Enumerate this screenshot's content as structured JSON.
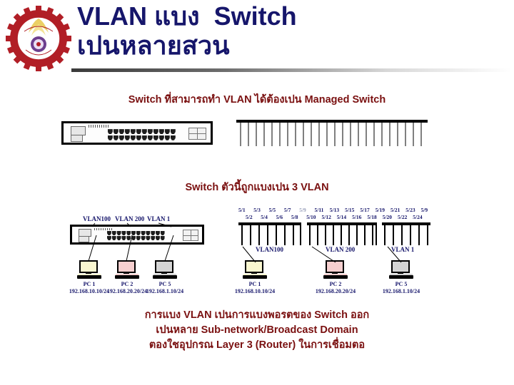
{
  "header": {
    "title_line1": "VLAN แบง  Switch",
    "title_line2": "เปนหลายสวน",
    "logo_name": "university-seal-logo",
    "title_color": "#16166b",
    "rule_color": "#3a3a3a"
  },
  "sections": {
    "caption1": "Switch ที่สามารถทำ VLAN ได้ต้องเปน Managed Switch",
    "caption2": "Switch ตัวนี้ถูกแบงเปน 3 VLAN"
  },
  "vlans": [
    {
      "name": "VLAN100",
      "ports": [
        "5/1",
        "5/2",
        "5/3",
        "5/4",
        "5/5",
        "5/6",
        "5/7",
        "5/8"
      ]
    },
    {
      "name": "VLAN 200",
      "ports": [
        "5/9",
        "5/10",
        "5/11",
        "5/12",
        "5/13",
        "5/14",
        "5/15",
        "5/16",
        "5/17",
        "5/18"
      ]
    },
    {
      "name": "VLAN 1",
      "ports": [
        "5/19",
        "5/20",
        "5/21",
        "5/22",
        "5/23",
        "5/24"
      ]
    }
  ],
  "port_labels_top": [
    "5/1",
    "5/3",
    "5/5",
    "5/7",
    "5/9",
    "5/11",
    "5/13",
    "5/15",
    "5/17",
    "5/19",
    "5/21",
    "5/23",
    "5/9"
  ],
  "port_labels_bottom": [
    "5/2",
    "5/4",
    "5/6",
    "5/8",
    "5/10",
    "5/12",
    "5/14",
    "5/16",
    "5/18",
    "5/20",
    "5/22",
    "5/24"
  ],
  "hosts": [
    {
      "name": "PC 1",
      "ip": "192.168.10.10/24",
      "color": "#faf7d0",
      "vlan": "VLAN100"
    },
    {
      "name": "PC 2",
      "ip": "192.168.20.20/24",
      "color": "#f6cfcf",
      "vlan": "VLAN 200"
    },
    {
      "name": "PC 5",
      "ip": "192.168.1.10/24",
      "color": "#d4d4d4",
      "vlan": "VLAN 1"
    }
  ],
  "footer": {
    "line1": "การแบง VLAN เปนการแบงพอรตของ Switch ออก",
    "line2": "เปนหลาย Sub-network/Broadcast Domain",
    "line3": "ตองใชอุปกรณ Layer 3 (Router) ในการเชื่อมตอ"
  }
}
